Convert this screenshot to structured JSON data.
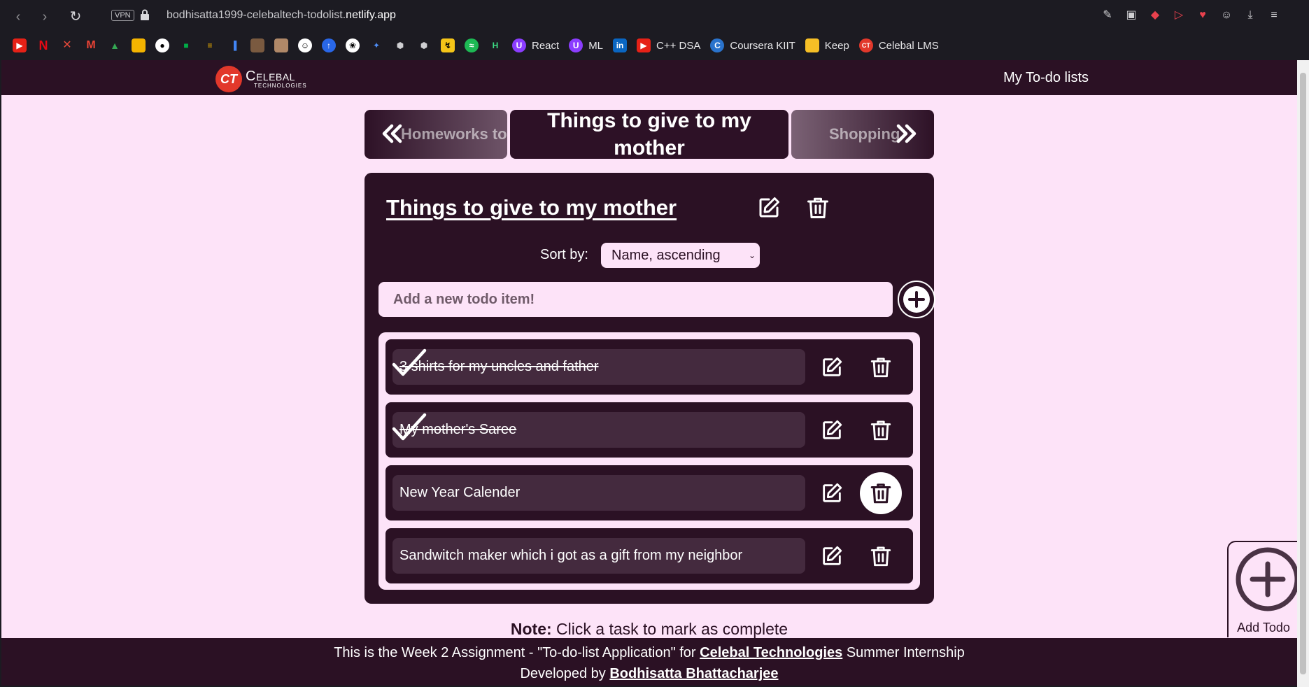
{
  "browser": {
    "url_prefix": "bodhisatta1999-celebaltech-todolist.",
    "url_domain": "netlify.app",
    "vpn_label": "VPN",
    "bookmarks": [
      {
        "label": "React"
      },
      {
        "label": "ML"
      },
      {
        "label": "C++ DSA"
      },
      {
        "label": "Coursera KIIT"
      },
      {
        "label": "Keep"
      },
      {
        "label": "Celebal LMS"
      }
    ]
  },
  "header": {
    "logo_mark": "CT",
    "logo_name": "Celebal",
    "logo_sub": "Technologies",
    "nav_link": "My To-do lists"
  },
  "tabs": {
    "prev": "Homeworks to do",
    "current": "Things to give to my mother",
    "next": "Shopping"
  },
  "list": {
    "title": "Things to give to my mother",
    "sort_label": "Sort by:",
    "sort_value": "Name, ascending",
    "add_placeholder": "Add a new todo item!",
    "items": [
      {
        "text": "3 shirts for my uncles and father",
        "done": true
      },
      {
        "text": "My mother's Saree",
        "done": true
      },
      {
        "text": "New Year Calender",
        "done": false
      },
      {
        "text": "Sandwitch maker which i got as a gift from my neighbor",
        "done": false
      }
    ]
  },
  "note": {
    "bold": "Note:",
    "text": " Click a task to mark as complete"
  },
  "footer": {
    "line1_a": "This is the Week 2 Assignment - \"To-do-list Application\" for ",
    "line1_link": "Celebal Technologies",
    "line1_b": " Summer Internship",
    "line2_a": "Developed by ",
    "line2_link": "Bodhisatta Bhattacharjee"
  },
  "float_button": {
    "label": "Add Todo"
  },
  "colors": {
    "primary": "#2b1124",
    "background": "#fde3f8",
    "item_bg": "#442a3e",
    "logo_red": "#e2382b"
  }
}
